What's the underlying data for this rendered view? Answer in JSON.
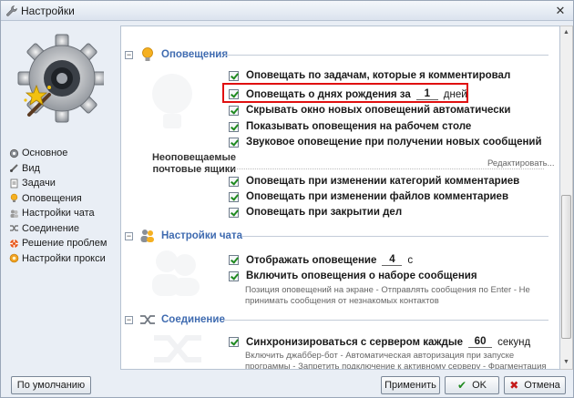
{
  "window": {
    "title": "Настройки"
  },
  "sidebar": {
    "items": [
      {
        "label": "Основное",
        "icon": "gear-icon"
      },
      {
        "label": "Вид",
        "icon": "brush-icon"
      },
      {
        "label": "Задачи",
        "icon": "document-icon"
      },
      {
        "label": "Оповещения",
        "icon": "bulb-icon"
      },
      {
        "label": "Настройки чата",
        "icon": "chat-icon"
      },
      {
        "label": "Соединение",
        "icon": "link-icon"
      },
      {
        "label": "Решение проблем",
        "icon": "lifebuoy-icon"
      },
      {
        "label": "Настройки прокси",
        "icon": "proxy-icon"
      }
    ]
  },
  "notifications": {
    "title": "Оповещения",
    "opt1": "Оповещать по задачам, которые я комментировал",
    "opt2_prefix": "Оповещать о днях рождения за",
    "opt2_value": "1",
    "opt2_unit": "дней",
    "opt3": "Скрывать окно новых оповещений автоматически",
    "opt4": "Показывать оповещения на рабочем столе",
    "opt5": "Звуковое оповещение при получении новых сообщений",
    "mailboxes_label": "Неоповещаемые почтовые ящики",
    "edit_link": "Редактировать...",
    "opt6": "Оповещать при изменении категорий комментариев",
    "opt7": "Оповещать при изменении файлов комментариев",
    "opt8": "Оповещать при закрытии дел"
  },
  "chat": {
    "title": "Настройки чата",
    "opt1_prefix": "Отображать оповещение",
    "opt1_value": "4",
    "opt1_unit": "с",
    "opt2": "Включить оповещения о наборе сообщения",
    "hint": "Позиция оповещений на экране - Отправлять сообщения по Enter - Не принимать сообщения от незнакомых контактов"
  },
  "connection": {
    "title": "Соединение",
    "opt1_prefix": "Синхронизироваться с сервером каждые",
    "opt1_value": "60",
    "opt1_unit": "секунд",
    "hint": "Включить джаббер-бот - Автоматическая авторизация при запуске программы - Запретить подключение к активному серверу - Фрагментация"
  },
  "buttons": {
    "defaults": "По умолчанию",
    "apply": "Применить",
    "ok": "OK",
    "cancel": "Отмена"
  },
  "colors": {
    "accent": "#3f6bb0",
    "highlight": "#e01010",
    "check": "#1f8a1f"
  }
}
